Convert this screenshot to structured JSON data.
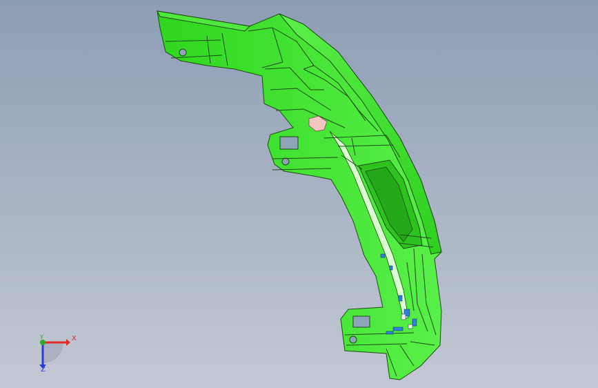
{
  "viewport": {
    "background_top": "#8c9db3",
    "background_bottom": "#c2c8d3"
  },
  "model": {
    "part_color": "#39e62a",
    "edge_color": "#1c4a12",
    "accent_blue": "#2f7fd6",
    "accent_pink": "#f2c7c0"
  },
  "triad": {
    "x_label": "X",
    "y_label": "Y",
    "z_label": "Z",
    "x_color": "#e32a2a",
    "y_color": "#2fa82f",
    "z_color": "#2a3bd6"
  }
}
